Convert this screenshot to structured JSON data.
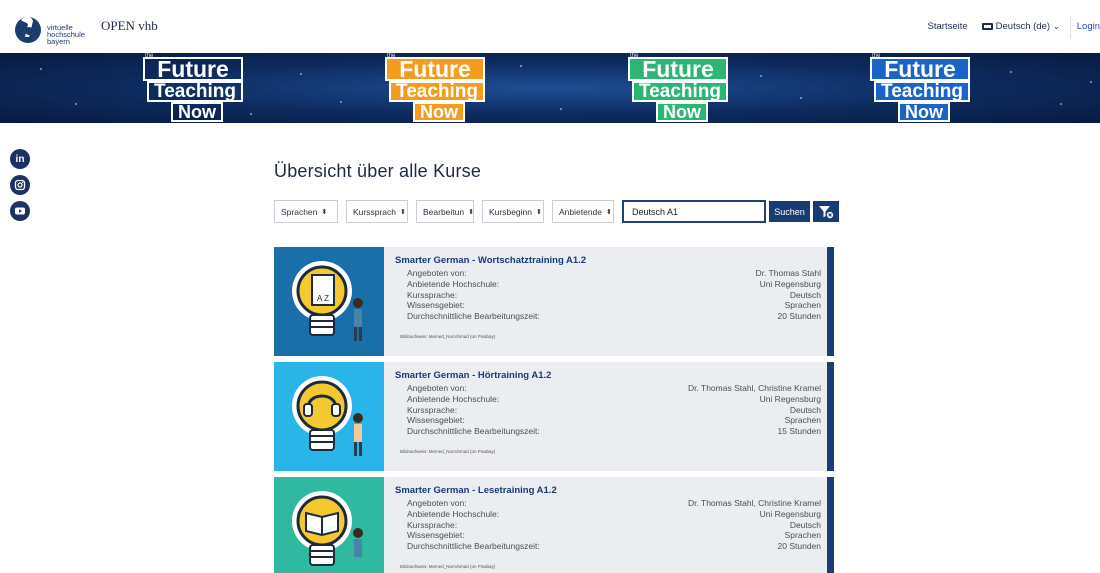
{
  "header": {
    "logo_lines": [
      "virtuelle",
      "hochschule",
      "bayern"
    ],
    "site_name": "OPEN vhb",
    "nav_home": "Startseite",
    "language": "Deutsch (de)",
    "login": "Login"
  },
  "banner": {
    "items": [
      {
        "small": "the",
        "line1": "Future",
        "line2": "Teaching",
        "line3": "Now",
        "accent": "#ffffff"
      },
      {
        "small": "the",
        "line1": "Future",
        "line2": "Teaching",
        "line3": "Now",
        "accent": "#f39c1f"
      },
      {
        "small": "the",
        "line1": "Future",
        "line2": "Teaching",
        "line3": "Now",
        "accent": "#2bb673"
      },
      {
        "small": "the",
        "line1": "Future",
        "line2": "Teaching",
        "line3": "Now",
        "accent": "#1b64c7"
      }
    ]
  },
  "social": [
    "linkedin-icon",
    "instagram-icon",
    "youtube-icon"
  ],
  "main": {
    "title": "Übersicht über alle Kurse",
    "filters": [
      "Sprachen",
      "Kurssprach",
      "Bearbeitun",
      "Kursbeginn",
      "Anbietende"
    ],
    "search_value": "Deutsch A1",
    "search_button": "Suchen"
  },
  "field_labels": {
    "provider": "Angeboten von:",
    "university": "Anbietende Hochschule:",
    "language": "Kurssprache:",
    "subject": "Wissensgebiet:",
    "duration": "Durchschnittliche Bearbeitungszeit:"
  },
  "courses": [
    {
      "title": "Smarter German - Wortschatztraining A1.2",
      "provider": "Dr. Thomas Stahl",
      "university": "Uni Regensburg",
      "language": "Deutsch",
      "subject": "Sprachen",
      "duration": "20 Stunden",
      "credit": "Bildnachweis: Memed_Nurrohmad (on Pixabay)",
      "image_bg": "#1a6fa8",
      "image_icon": "book-az-icon"
    },
    {
      "title": "Smarter German - Hörtraining A1.2",
      "provider": "Dr. Thomas Stahl, Christine Kramel",
      "university": "Uni Regensburg",
      "language": "Deutsch",
      "subject": "Sprachen",
      "duration": "15 Stunden",
      "credit": "Bildnachweis: Memed_Nurrohmad (on Pixabay)",
      "image_bg": "#2ab5e8",
      "image_icon": "headphones-icon"
    },
    {
      "title": "Smarter German - Lesetraining A1.2",
      "provider": "Dr. Thomas Stahl, Christine Kramel",
      "university": "Uni Regensburg",
      "language": "Deutsch",
      "subject": "Sprachen",
      "duration": "20 Stunden",
      "credit": "Bildnachweis: Memed_Nurrohmad (on Pixabay)",
      "image_bg": "#2fb9a0",
      "image_icon": "open-book-icon"
    }
  ]
}
